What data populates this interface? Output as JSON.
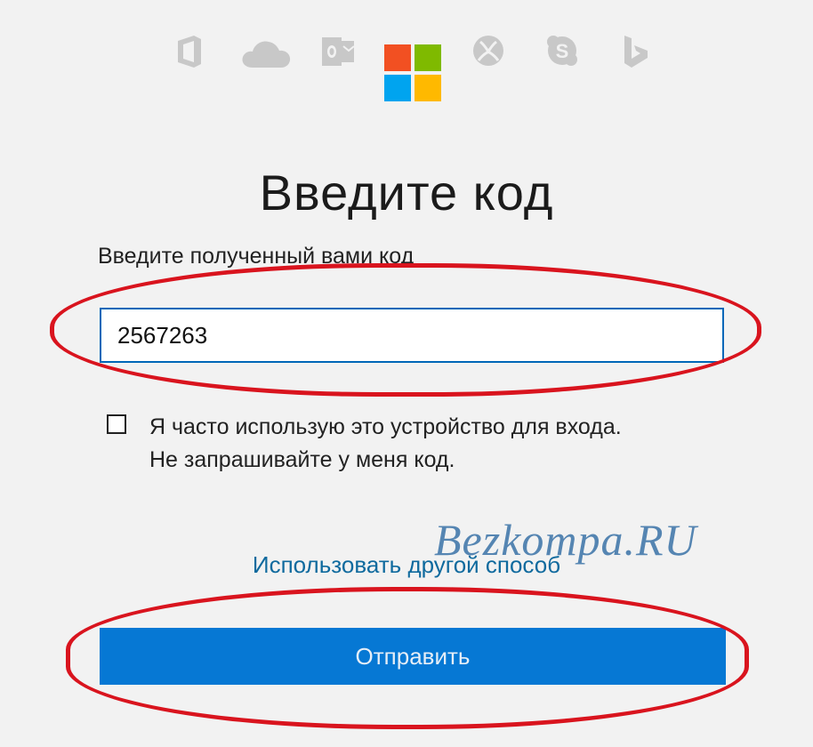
{
  "header": {
    "product_icons": [
      "office-icon",
      "onedrive-icon",
      "outlook-icon",
      "microsoft-logo",
      "xbox-icon",
      "skype-icon",
      "bing-icon"
    ],
    "logo_colors": [
      "#f25022",
      "#7fba00",
      "#00a4ef",
      "#ffb900"
    ]
  },
  "page": {
    "title": "Введите код"
  },
  "code_field": {
    "label": "Введите полученный вами код",
    "value": "2567263"
  },
  "remember": {
    "checked": false,
    "line1": "Я часто использую это устройство для входа.",
    "line2": "Не запрашивайте у меня код."
  },
  "watermark": "Bezkompa.RU",
  "alt_method_link": "Использовать другой способ",
  "submit_label": "Отправить",
  "colors": {
    "accent": "#0678d4",
    "link": "#0f6a9e",
    "highlight": "#d9141e"
  }
}
